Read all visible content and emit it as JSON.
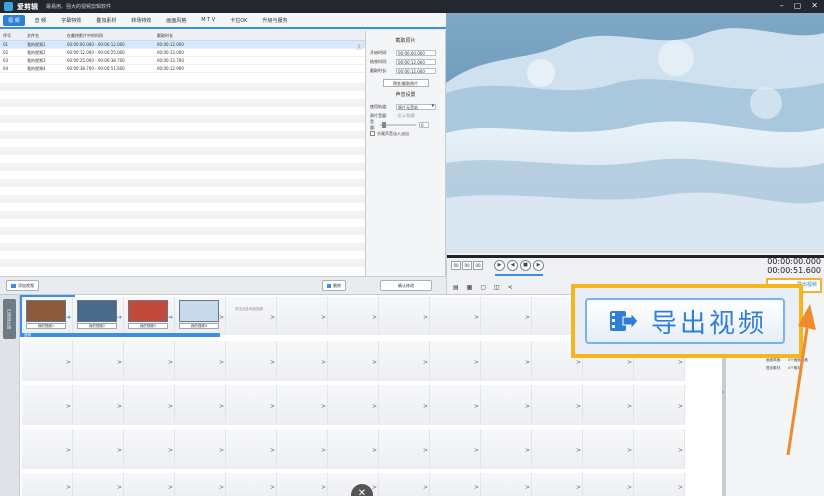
{
  "titlebar": {
    "app_name": "爱剪辑",
    "slogan": "最易用、强大的视频剪辑软件",
    "window_controls": [
      "–",
      "▢",
      "✕"
    ]
  },
  "menu": {
    "tabs": [
      {
        "label": "视 频",
        "active": true
      },
      {
        "label": "音 频",
        "active": false
      },
      {
        "label": "字幕特效",
        "active": false
      },
      {
        "label": "叠加素材",
        "active": false
      },
      {
        "label": "转场特效",
        "active": false
      },
      {
        "label": "画面风格",
        "active": false
      },
      {
        "label": "M T V",
        "active": false
      },
      {
        "label": "卡拉OK",
        "active": false
      },
      {
        "label": "升级与服务",
        "active": false
      }
    ]
  },
  "media_list": {
    "columns": [
      "序号",
      "文件名",
      "在最终影片中的时间",
      "截取时长"
    ],
    "rows": [
      {
        "index": "01",
        "name": "我的视频1",
        "time": "00:00:00.000 - 00:00:12.000",
        "duration": "00:00:12.000"
      },
      {
        "index": "02",
        "name": "我的视频2",
        "time": "00:00:12.000 - 00:00:25.000",
        "duration": "00:00:13.000"
      },
      {
        "index": "03",
        "name": "我的视频3",
        "time": "00:00:25.000 - 00:00:38.700",
        "duration": "00:00:13.700"
      },
      {
        "index": "04",
        "name": "我的视频4",
        "time": "00:00:38.700 - 00:00:51.600",
        "duration": "00:00:12.900"
      }
    ],
    "selected_row": 0
  },
  "props": {
    "clip_title": "截取原片",
    "start_label": "开始时间:",
    "start_value": "00:00:00.000",
    "end_label": "结束时间:",
    "end_value": "00:00:12.000",
    "duration_label": "截取时长:",
    "duration_value": "00:00:12.000",
    "preview_button": "预览/截取原片",
    "audio_title": "声音设置",
    "audio_track_label": "使用轨道:",
    "audio_track_value": "原片无音轨",
    "gain_label": "原片音量:",
    "gain_hint": "-显示/隐藏",
    "volume_label": "音量:",
    "volume_value": "0",
    "fade_label": "头尾声音淡入淡出"
  },
  "listbar": {
    "add_video": "添加视频",
    "delete": "删除",
    "confirm": "确认修改"
  },
  "player": {
    "time_boxes": [
      "00",
      "00",
      "00"
    ],
    "current_time": "00:00:00.000",
    "total_time": "00:00:51.600",
    "tool_icons": [
      "folder-icon",
      "save-icon",
      "crop-icon",
      "snapshot-icon",
      "share-icon"
    ]
  },
  "export_small_label": "导出视频",
  "timeline": {
    "side_tab": "已添加片段",
    "clips": [
      {
        "name": "我的视频1",
        "color": "#8a5a3a"
      },
      {
        "name": "我的视频2",
        "color": "#4a6a8a"
      },
      {
        "name": "我的视频3",
        "color": "#c24a3a"
      },
      {
        "name": "我的视频4",
        "color": "#c8d9ea"
      }
    ],
    "empty_slot_label": "双击此处添加视频",
    "track_label": "音频"
  },
  "info_panel": {
    "lines": [
      "画面风格：",
      "叠加素材：",
      "0个画面风格",
      "0个素材"
    ]
  },
  "callout": {
    "label": "导出视频",
    "highlight_color": "#f5b51d",
    "arrow_color": "#f08a2c"
  }
}
